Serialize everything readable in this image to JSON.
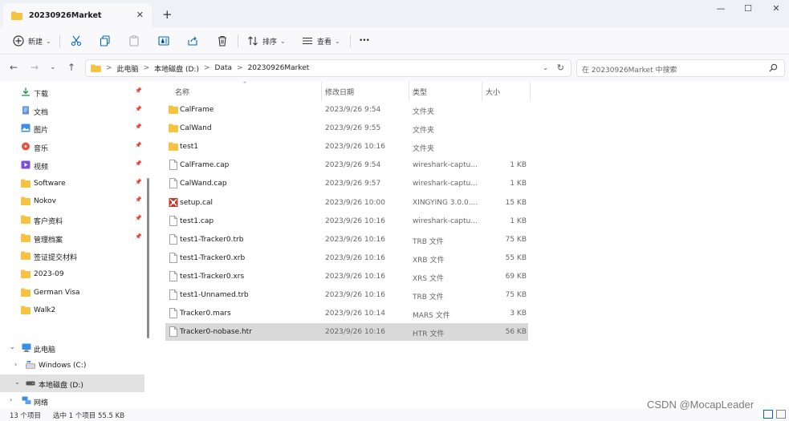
{
  "window": {
    "tab_title": "20230926Market",
    "tab_close": "✕",
    "new_tab": "+",
    "minimize": "—",
    "maximize": "☐",
    "close": "✕"
  },
  "toolbar": {
    "new_label": "新建",
    "sort_label": "排序",
    "view_label": "查看",
    "more_label": "•••"
  },
  "address": {
    "crumbs": [
      "此电脑",
      "本地磁盘 (D:)",
      "Data",
      "20230926Market"
    ],
    "separator": ">",
    "search_placeholder": "在 20230926Market 中搜索"
  },
  "nav_pane": {
    "quick_items": [
      {
        "label": "下载",
        "icon": "download-icon",
        "pinned": true
      },
      {
        "label": "文档",
        "icon": "document-icon",
        "pinned": true
      },
      {
        "label": "图片",
        "icon": "picture-icon",
        "pinned": true
      },
      {
        "label": "音乐",
        "icon": "music-icon",
        "pinned": true
      },
      {
        "label": "视频",
        "icon": "video-icon",
        "pinned": true
      },
      {
        "label": "Software",
        "icon": "folder-icon",
        "pinned": true
      },
      {
        "label": "Nokov",
        "icon": "folder-icon",
        "pinned": true
      },
      {
        "label": "客户资料",
        "icon": "folder-icon",
        "pinned": true
      },
      {
        "label": "管理档案",
        "icon": "folder-icon",
        "pinned": true
      },
      {
        "label": "签证提交材料",
        "icon": "folder-icon",
        "pinned": false
      },
      {
        "label": "2023-09",
        "icon": "folder-icon",
        "pinned": false
      },
      {
        "label": "German Visa",
        "icon": "folder-icon",
        "pinned": false
      },
      {
        "label": "Walk2",
        "icon": "folder-icon",
        "pinned": false
      }
    ],
    "this_pc": "此电脑",
    "windows_c": "Windows (C:)",
    "local_d": "本地磁盘 (D:)",
    "network": "网络"
  },
  "columns": {
    "name": "名称",
    "date": "修改日期",
    "type": "类型",
    "size": "大小"
  },
  "files": [
    {
      "name": "CalFrame",
      "date": "2023/9/26 9:54",
      "type": "文件夹",
      "size": "",
      "icon": "folder-icon"
    },
    {
      "name": "CalWand",
      "date": "2023/9/26 9:55",
      "type": "文件夹",
      "size": "",
      "icon": "folder-icon"
    },
    {
      "name": "test1",
      "date": "2023/9/26 10:16",
      "type": "文件夹",
      "size": "",
      "icon": "folder-icon"
    },
    {
      "name": "CalFrame.cap",
      "date": "2023/9/26 9:54",
      "type": "wireshark-captu...",
      "size": "1 KB",
      "icon": "file-icon"
    },
    {
      "name": "CalWand.cap",
      "date": "2023/9/26 9:57",
      "type": "wireshark-captu...",
      "size": "1 KB",
      "icon": "file-icon"
    },
    {
      "name": "setup.cal",
      "date": "2023/9/26 10:00",
      "type": "XINGYING 3.0.0....",
      "size": "15 KB",
      "icon": "xingying-icon"
    },
    {
      "name": "test1.cap",
      "date": "2023/9/26 10:16",
      "type": "wireshark-captu...",
      "size": "1 KB",
      "icon": "file-icon"
    },
    {
      "name": "test1-Tracker0.trb",
      "date": "2023/9/26 10:16",
      "type": "TRB 文件",
      "size": "75 KB",
      "icon": "file-icon"
    },
    {
      "name": "test1-Tracker0.xrb",
      "date": "2023/9/26 10:16",
      "type": "XRB 文件",
      "size": "55 KB",
      "icon": "file-icon"
    },
    {
      "name": "test1-Tracker0.xrs",
      "date": "2023/9/26 10:16",
      "type": "XRS 文件",
      "size": "69 KB",
      "icon": "file-icon"
    },
    {
      "name": "test1-Unnamed.trb",
      "date": "2023/9/26 10:16",
      "type": "TRB 文件",
      "size": "75 KB",
      "icon": "file-icon"
    },
    {
      "name": "Tracker0.mars",
      "date": "2023/9/26 10:14",
      "type": "MARS 文件",
      "size": "3 KB",
      "icon": "file-icon"
    },
    {
      "name": "Tracker0-nobase.htr",
      "date": "2023/9/26 10:16",
      "type": "HTR 文件",
      "size": "56 KB",
      "icon": "file-icon",
      "selected": true
    }
  ],
  "status": {
    "item_count": "13 个项目",
    "selection": "选中 1 个项目 55.5 KB"
  },
  "watermark": "CSDN @MocapLeader",
  "colors": {
    "folder": "#f5c242",
    "accent": "#0067c0",
    "selected_row": "#d9d9d9"
  }
}
